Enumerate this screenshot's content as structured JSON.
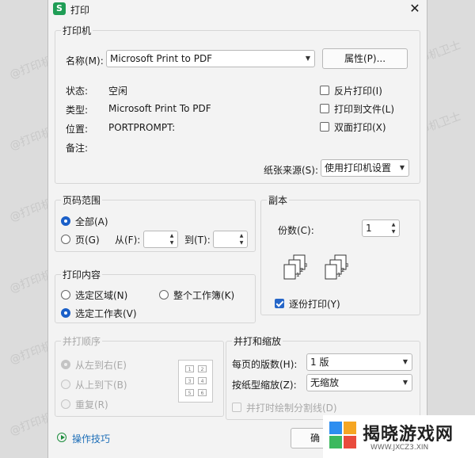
{
  "window": {
    "title": "打印",
    "app_icon": "S"
  },
  "printer": {
    "legend": "打印机",
    "name_label": "名称(M):",
    "name_value": "Microsoft Print to PDF",
    "properties_button": "属性(P)...",
    "status_label": "状态:",
    "status_value": "空闲",
    "type_label": "类型:",
    "type_value": "Microsoft Print To PDF",
    "location_label": "位置:",
    "location_value": "PORTPROMPT:",
    "comment_label": "备注:",
    "reverse_print": "反片打印(I)",
    "print_to_file": "打印到文件(L)",
    "duplex": "双面打印(X)",
    "paper_source_label": "纸张来源(S):",
    "paper_source_value": "使用打印机设置"
  },
  "page_range": {
    "legend": "页码范围",
    "all": "全部(A)",
    "pages": "页(G)",
    "from": "从(F):",
    "to": "到(T):"
  },
  "copies": {
    "legend": "副本",
    "count_label": "份数(C):",
    "count_value": "1",
    "collate": "逐份打印(Y)"
  },
  "print_content": {
    "legend": "打印内容",
    "selection": "选定区域(N)",
    "whole_workbook": "整个工作簿(K)",
    "selected_sheets": "选定工作表(V)"
  },
  "print_order": {
    "legend": "并打顺序",
    "left_to_right": "从左到右(E)",
    "top_to_bottom": "从上到下(B)",
    "repeat": "重复(R)",
    "grid": [
      "1",
      "2",
      "3",
      "4",
      "5",
      "6"
    ]
  },
  "combine_scale": {
    "legend": "并打和缩放",
    "pages_per_sheet_label": "每页的版数(H):",
    "pages_per_sheet_value": "1 版",
    "scale_label": "按纸型缩放(Z):",
    "scale_value": "无缩放",
    "draw_lines": "并打时绘制分割线(D)"
  },
  "footer": {
    "tips_link": "操作技巧",
    "ok_button_partial": "确"
  },
  "watermark_text": "@打印机卫士",
  "logo": {
    "text": "揭晓游戏网",
    "sub": "WWW.JXCZ3.XIN"
  },
  "colors": {
    "accent": "#1a5fc8",
    "help_link": "#1e6fb8",
    "app_green": "#1f9d55"
  }
}
